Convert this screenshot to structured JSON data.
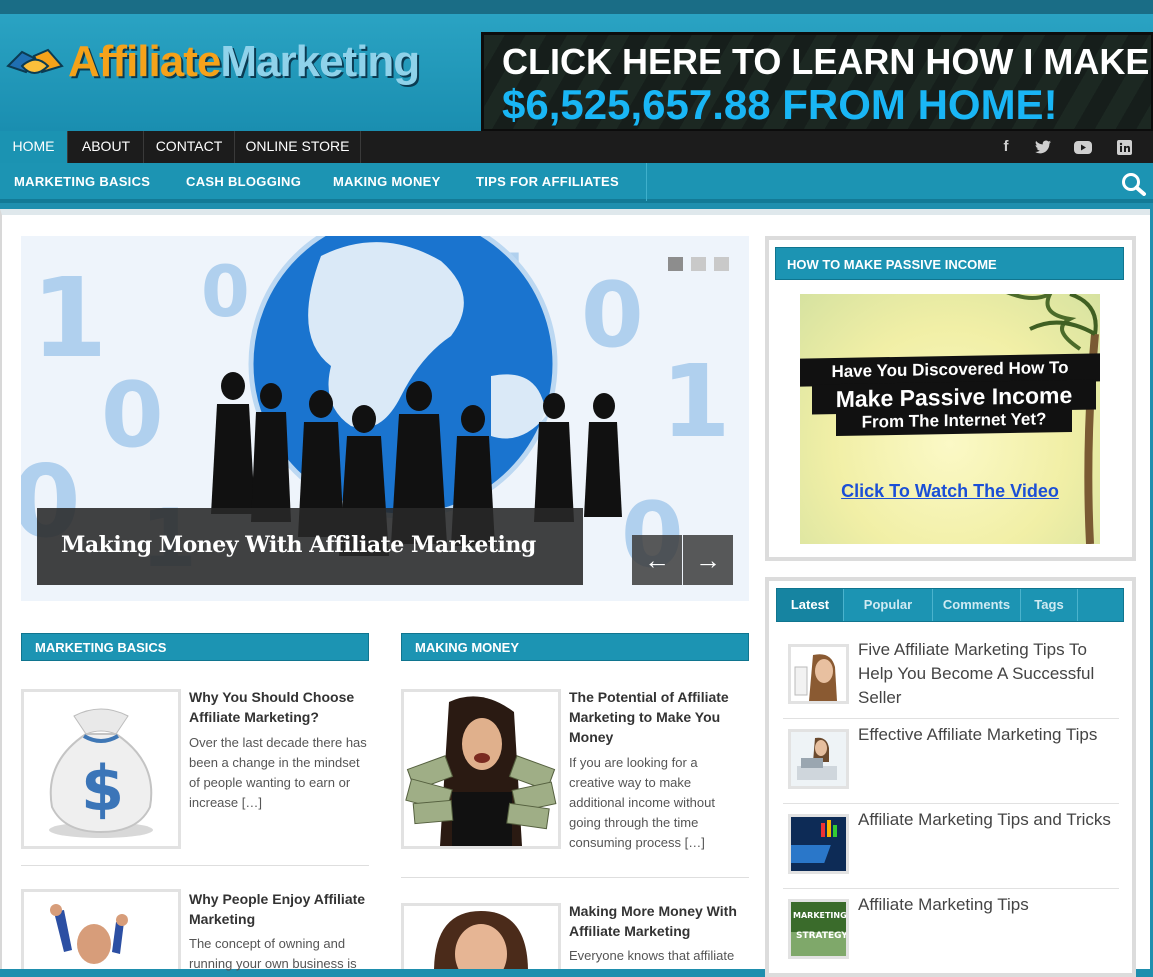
{
  "header": {
    "logo_part1": "Affiliate",
    "logo_part2": "Marketing",
    "banner_line1": "CLICK HERE TO LEARN HOW I MAKE",
    "banner_line2": "$6,525,657.88 FROM HOME!"
  },
  "topnav": {
    "items": [
      "HOME",
      "ABOUT",
      "CONTACT",
      "ONLINE STORE"
    ],
    "social": [
      "facebook-icon",
      "twitter-icon",
      "youtube-icon",
      "linkedin-icon"
    ]
  },
  "catnav": {
    "items": [
      "MARKETING BASICS",
      "CASH BLOGGING",
      "MAKING MONEY",
      "TIPS FOR AFFILIATES"
    ]
  },
  "slider": {
    "caption": "Making Money With Affiliate Marketing",
    "prev": "←",
    "next": "→"
  },
  "sections": {
    "left_title": "MARKETING BASICS",
    "right_title": "MAKING MONEY"
  },
  "posts": {
    "left": [
      {
        "title": "Why You Should Choose Affiliate Marketing?",
        "excerpt": "Over the last decade there has been a change in the mindset of people wanting to earn or increase […]"
      },
      {
        "title": "Why People Enjoy Affiliate Marketing",
        "excerpt": "The concept of owning and running your own business is"
      }
    ],
    "right": [
      {
        "title": "The Potential of Affiliate Marketing to Make You Money",
        "excerpt": "If you are looking for a creative way to make additional income without going through the time consuming process […]"
      },
      {
        "title": "Making More Money With Affiliate Marketing",
        "excerpt": "Everyone knows that affiliate"
      }
    ]
  },
  "sidebar": {
    "widget_title": "HOW TO MAKE PASSIVE INCOME",
    "ad_line1": "Have You Discovered How To",
    "ad_line2": "Make Passive Income",
    "ad_line3": "From The Internet Yet?",
    "ad_link": "Click To Watch The Video",
    "tabs": [
      "Latest",
      "Popular",
      "Comments",
      "Tags"
    ],
    "latest": [
      "Five Affiliate Marketing Tips To Help You Become A Successful Seller",
      "Effective Affiliate Marketing Tips",
      "Affiliate Marketing Tips and Tricks",
      "Affiliate Marketing Tips"
    ],
    "thumb4_text1": "MARKETING",
    "thumb4_text2": "STRATEGY"
  }
}
